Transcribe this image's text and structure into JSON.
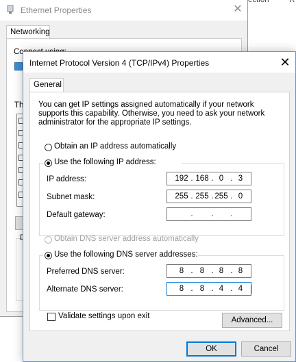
{
  "background_window": {
    "title": "Ethernet Properties",
    "close_glyph": "✕",
    "tab": "Networking",
    "connect_label_partial": "Connect using:",
    "this_label_partial": "Th",
    "d_label_partial": "D",
    "right_partial_1": "ection",
    "right_partial_2": "R"
  },
  "dialog": {
    "title": "Internet Protocol Version 4 (TCP/IPv4) Properties",
    "close_glyph": "✕",
    "tab": "General",
    "intro": "You can get IP settings assigned automatically if your network supports this capability. Otherwise, you need to ask your network administrator for the appropriate IP settings.",
    "ip_mode": {
      "auto_label": "Obtain an IP address automatically",
      "manual_label": "Use the following IP address:",
      "selected": "manual"
    },
    "ip_fields": [
      {
        "label": "IP address:",
        "octets": [
          "192",
          "168",
          "0",
          "3"
        ]
      },
      {
        "label": "Subnet mask:",
        "octets": [
          "255",
          "255",
          "255",
          "0"
        ]
      },
      {
        "label": "Default gateway:",
        "octets": [
          "",
          "",
          "",
          ""
        ]
      }
    ],
    "dns_mode": {
      "auto_label": "Obtain DNS server address automatically",
      "manual_label": "Use the following DNS server addresses:",
      "selected": "manual"
    },
    "dns_fields": [
      {
        "label": "Preferred DNS server:",
        "octets": [
          "8",
          "8",
          "8",
          "8"
        ]
      },
      {
        "label": "Alternate DNS server:",
        "octets": [
          "8",
          "8",
          "4",
          "4"
        ]
      }
    ],
    "validate_label": "Validate settings upon exit",
    "validate_checked": false,
    "advanced_label": "Advanced...",
    "ok_label": "OK",
    "cancel_label": "Cancel"
  },
  "colors": {
    "window_bg": "#f0f0f0",
    "focus_blue": "#0078d7",
    "disabled_text": "#a0a0a0"
  }
}
